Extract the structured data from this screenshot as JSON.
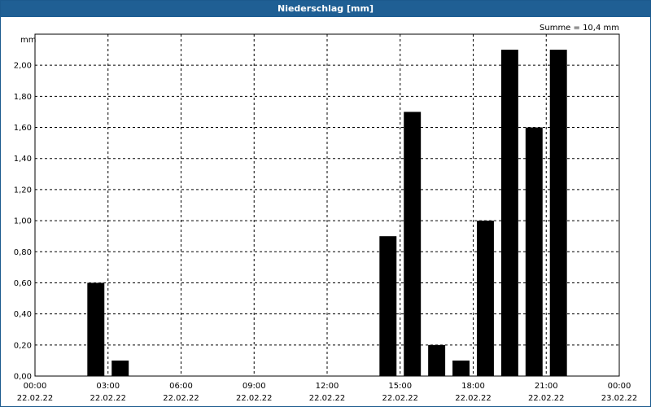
{
  "window": {
    "title": "Niederschlag [mm]"
  },
  "chart_data": {
    "type": "bar",
    "title": "Niederschlag [mm]",
    "ylabel": "mm",
    "annotation": "Summe = 10,4 mm",
    "ylim": [
      0,
      2.2
    ],
    "yticks": [
      "0,00",
      "0,20",
      "0,40",
      "0,60",
      "0,80",
      "1,00",
      "1,20",
      "1,40",
      "1,60",
      "1,80",
      "2,00"
    ],
    "xlim_hours": [
      0,
      24
    ],
    "xticks": [
      {
        "time": "00:00",
        "date": "22.02.22"
      },
      {
        "time": "03:00",
        "date": "22.02.22"
      },
      {
        "time": "06:00",
        "date": "22.02.22"
      },
      {
        "time": "09:00",
        "date": "22.02.22"
      },
      {
        "time": "12:00",
        "date": "22.02.22"
      },
      {
        "time": "15:00",
        "date": "22.02.22"
      },
      {
        "time": "18:00",
        "date": "22.02.22"
      },
      {
        "time": "21:00",
        "date": "22.02.22"
      },
      {
        "time": "00:00",
        "date": "23.02.22"
      }
    ],
    "bars": [
      {
        "hour": "02:30",
        "value": 0.6
      },
      {
        "hour": "03:30",
        "value": 0.1
      },
      {
        "hour": "14:30",
        "value": 0.9
      },
      {
        "hour": "15:30",
        "value": 1.7
      },
      {
        "hour": "16:30",
        "value": 0.2
      },
      {
        "hour": "17:30",
        "value": 0.1
      },
      {
        "hour": "18:30",
        "value": 1.0
      },
      {
        "hour": "19:30",
        "value": 2.1
      },
      {
        "hour": "20:30",
        "value": 1.6
      },
      {
        "hour": "21:30",
        "value": 2.1
      }
    ],
    "grid": true,
    "colors": {
      "bar": "#000000",
      "grid": "#000000",
      "title_bg": "#1f5f94"
    }
  }
}
